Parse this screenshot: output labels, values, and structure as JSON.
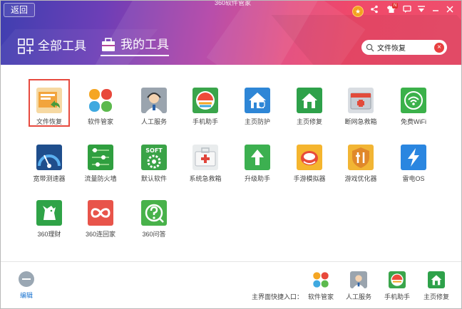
{
  "header": {
    "back_label": "返回",
    "window_title": "360软件管家",
    "tabs": [
      {
        "label": "全部工具",
        "icon": "grid-plus-icon",
        "active": false
      },
      {
        "label": "我的工具",
        "icon": "toolbox-icon",
        "active": true
      }
    ],
    "search_value": "文件恢复",
    "top_icons": [
      "medal-icon",
      "share-icon",
      "shirt-icon",
      "message-icon",
      "menu-icon",
      "minimize-icon",
      "close-icon"
    ]
  },
  "tools": [
    {
      "label": "文件恢复",
      "icon": "file-restore-icon",
      "selected": true
    },
    {
      "label": "软件管家",
      "icon": "software-manager-icon"
    },
    {
      "label": "人工服务",
      "icon": "customer-service-icon"
    },
    {
      "label": "手机助手",
      "icon": "phone-assistant-icon"
    },
    {
      "label": "主页防护",
      "icon": "homepage-protect-icon"
    },
    {
      "label": "主页修复",
      "icon": "homepage-repair-icon"
    },
    {
      "label": "断网急救箱",
      "icon": "network-firstaid-icon"
    },
    {
      "label": "免费WiFi",
      "icon": "wifi-icon"
    },
    {
      "label": "宽带测速器",
      "icon": "speedtest-icon"
    },
    {
      "label": "流量防火墙",
      "icon": "traffic-firewall-icon"
    },
    {
      "label": "默认软件",
      "icon": "default-software-icon"
    },
    {
      "label": "系统急救箱",
      "icon": "system-firstaid-icon"
    },
    {
      "label": "升级助手",
      "icon": "upgrade-icon"
    },
    {
      "label": "手游模拟器",
      "icon": "game-emulator-icon"
    },
    {
      "label": "游戏优化器",
      "icon": "game-optimizer-icon"
    },
    {
      "label": "雷电OS",
      "icon": "thunder-os-icon"
    },
    {
      "label": "360理财",
      "icon": "finance-icon"
    },
    {
      "label": "360连回家",
      "icon": "connect-home-icon"
    },
    {
      "label": "360问答",
      "icon": "qa-icon"
    }
  ],
  "footer": {
    "edit_label": "编辑",
    "shortcut_label": "主界面快捷入口：",
    "shortcuts": [
      {
        "label": "软件管家",
        "icon": "software-manager-icon"
      },
      {
        "label": "人工服务",
        "icon": "customer-service-icon"
      },
      {
        "label": "手机助手",
        "icon": "phone-assistant-icon"
      },
      {
        "label": "主页修复",
        "icon": "homepage-repair-icon"
      }
    ]
  },
  "colors": {
    "accent_red": "#e74a3f",
    "link_blue": "#1b74d0"
  }
}
